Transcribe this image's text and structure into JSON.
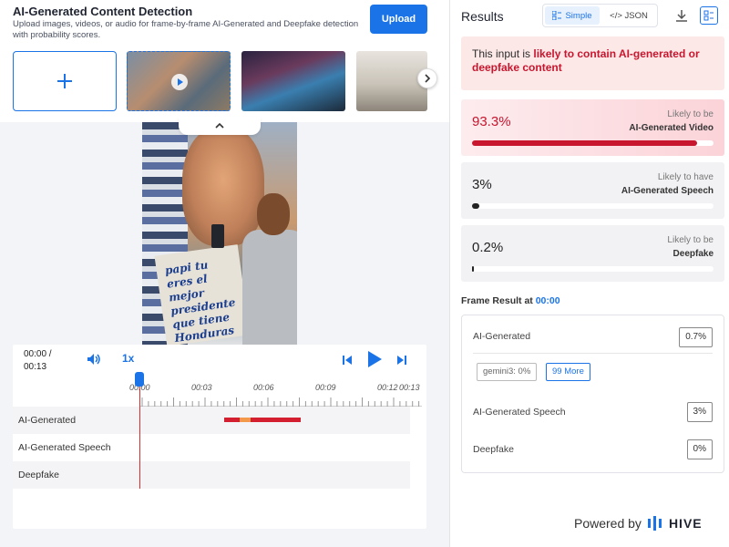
{
  "header": {
    "title": "AI-Generated Content Detection",
    "subtitle": "Upload images, videos, or audio for frame-by-frame AI-Generated and Deepfake detection with probability scores.",
    "upload_label": "Upload"
  },
  "thumbnails": {
    "add_label": "+",
    "items": [
      {
        "name": "thumbnail-video-1",
        "selected": true
      },
      {
        "name": "thumbnail-image-2",
        "selected": false
      },
      {
        "name": "thumbnail-image-3",
        "selected": false
      }
    ]
  },
  "video": {
    "sign_text": "papi tu eres el mejor presidente que tiene Honduras"
  },
  "player": {
    "time_current": "00:00 /",
    "time_total": "00:13",
    "speed": "1x",
    "tick_labels": [
      "00:00",
      "00:03",
      "00:06",
      "00:09",
      "00:12",
      "00:13"
    ],
    "tracks": [
      "AI-Generated",
      "AI-Generated Speech",
      "Deepfake"
    ],
    "segments": [
      {
        "start": 0.31,
        "end": 0.365,
        "color": "#d41f30"
      },
      {
        "start": 0.365,
        "end": 0.405,
        "color": "#f2994a"
      },
      {
        "start": 0.405,
        "end": 0.59,
        "color": "#d41f30"
      }
    ]
  },
  "results": {
    "title": "Results",
    "view_simple": "Simple",
    "view_json": "</> JSON",
    "verdict_prefix": "This input is ",
    "verdict_emphasis": "likely to contain AI-generated or deepfake content",
    "cards": [
      {
        "value": "93.3%",
        "pre": "Likely to be",
        "name": "AI-Generated Video",
        "fill": 0.933
      },
      {
        "value": "3%",
        "pre": "Likely to have",
        "name": "AI-Generated Speech",
        "fill": 0.03
      },
      {
        "value": "0.2%",
        "pre": "Likely to be",
        "name": "Deepfake",
        "fill": 0.002
      }
    ],
    "frame_heading": "Frame Result at ",
    "frame_time": "00:00",
    "frame_rows": [
      {
        "label": "AI-Generated",
        "value": "0.7%"
      },
      {
        "label": "AI-Generated Speech",
        "value": "3%"
      },
      {
        "label": "Deepfake",
        "value": "0%"
      }
    ],
    "model_chip": "gemini3: 0%",
    "more_label": "99 More"
  },
  "footer": {
    "powered_by": "Powered by",
    "brand": "HIVE"
  },
  "colors": {
    "accent": "#1b73e8",
    "danger": "#c8162e",
    "warning": "#f2994a"
  }
}
